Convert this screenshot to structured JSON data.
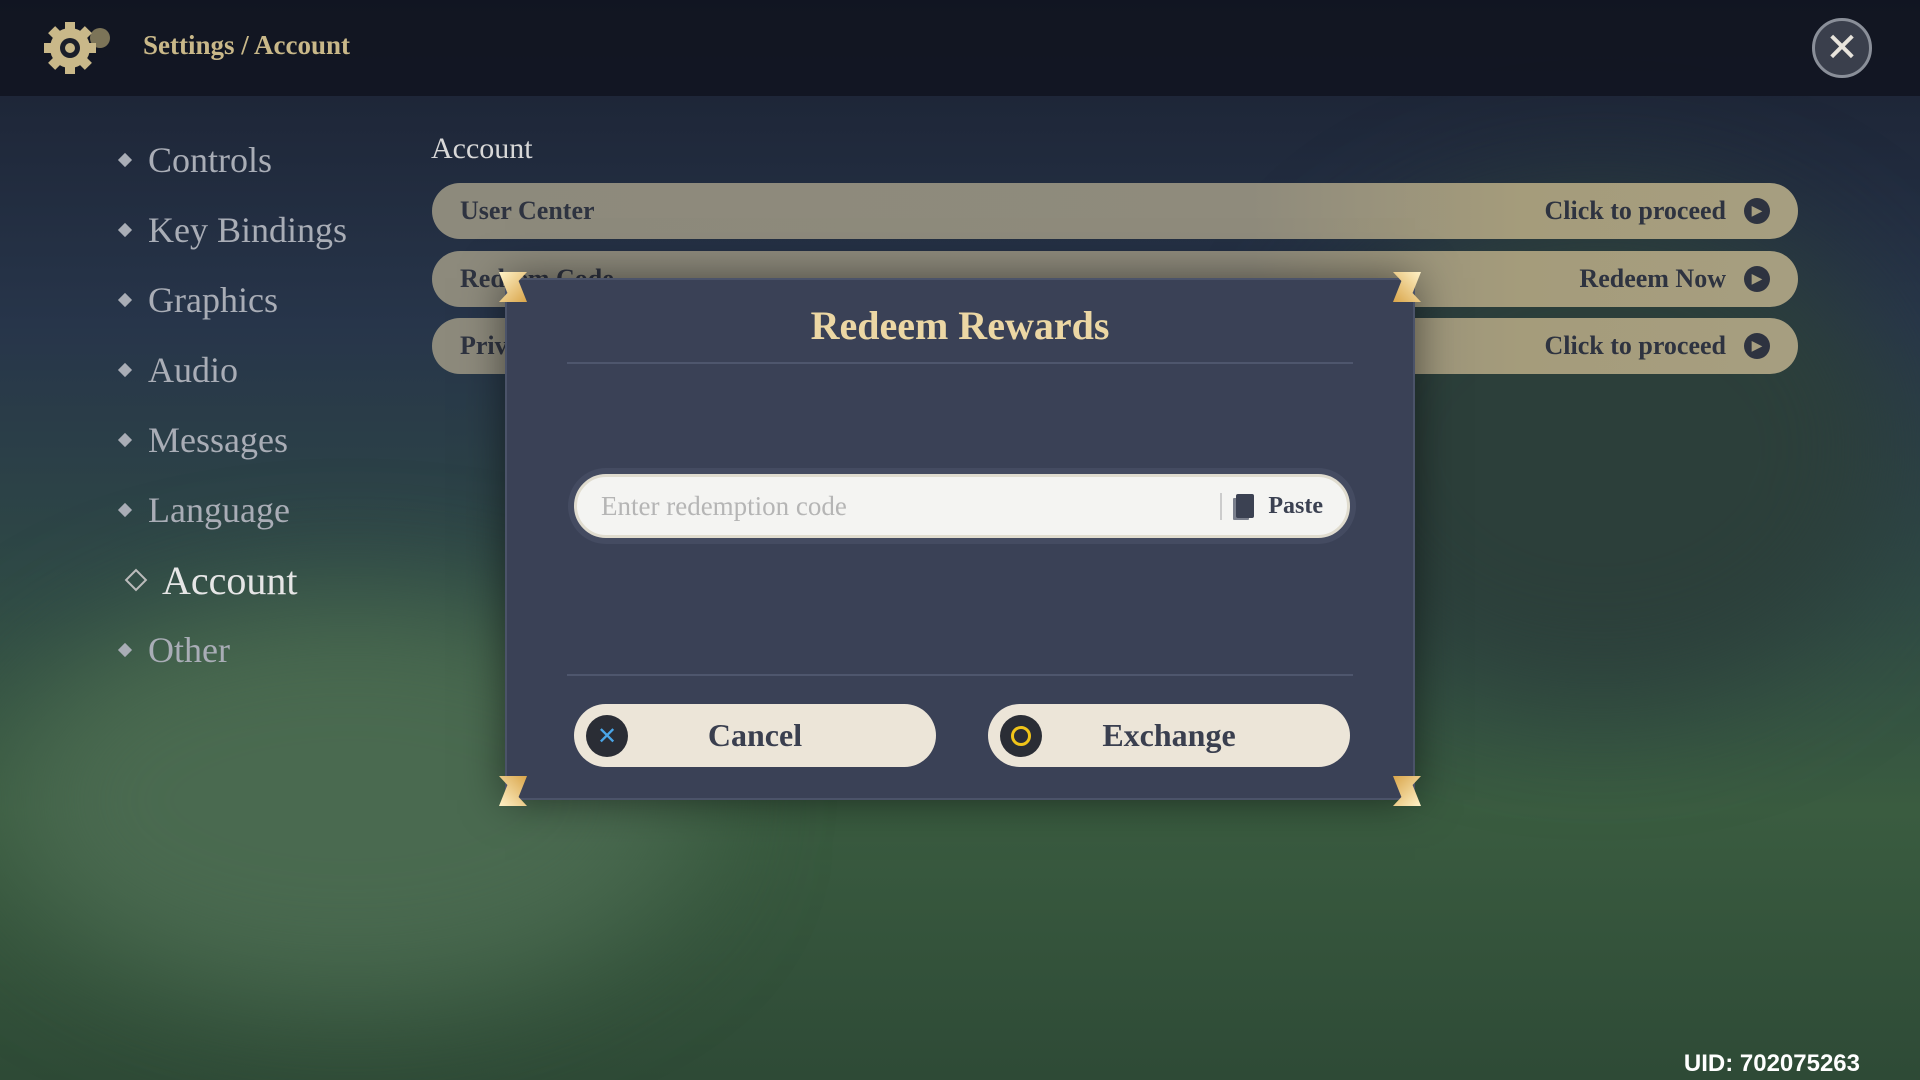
{
  "header": {
    "breadcrumb": "Settings / Account",
    "icon": "gear-icon",
    "close_icon": "close-icon"
  },
  "sidebar": {
    "items": [
      {
        "label": "Controls"
      },
      {
        "label": "Key Bindings"
      },
      {
        "label": "Graphics"
      },
      {
        "label": "Audio"
      },
      {
        "label": "Messages"
      },
      {
        "label": "Language"
      },
      {
        "label": "Account",
        "active": true
      },
      {
        "label": "Other"
      }
    ]
  },
  "main": {
    "section_title": "Account",
    "rows": [
      {
        "label": "User Center",
        "action": "Click to proceed"
      },
      {
        "label": "Redeem Code",
        "action": "Redeem Now"
      },
      {
        "label": "Privacy",
        "action": "Click to proceed"
      }
    ]
  },
  "dialog": {
    "title": "Redeem Rewards",
    "input": {
      "value": "",
      "placeholder": "Enter redemption code"
    },
    "paste_label": "Paste",
    "cancel_label": "Cancel",
    "exchange_label": "Exchange",
    "accent": "#ecd7a4"
  },
  "footer": {
    "uid": "UID: 702075263"
  }
}
